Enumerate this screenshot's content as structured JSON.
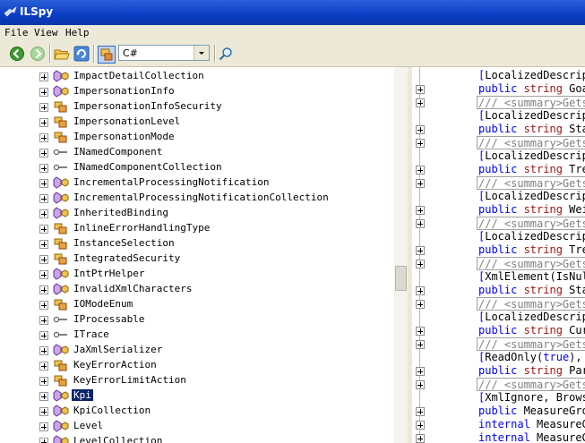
{
  "window": {
    "title": "ILSpy"
  },
  "menu": [
    "File",
    "View",
    "Help"
  ],
  "toolbar": {
    "language": "C#"
  },
  "tree": {
    "items": [
      {
        "label": "ImpactDetailCollection",
        "icon": "class"
      },
      {
        "label": "ImpersonationInfo",
        "icon": "class"
      },
      {
        "label": "ImpersonationInfoSecurity",
        "icon": "enum"
      },
      {
        "label": "ImpersonationLevel",
        "icon": "enum"
      },
      {
        "label": "ImpersonationMode",
        "icon": "enum"
      },
      {
        "label": "INamedComponent",
        "icon": "interface"
      },
      {
        "label": "INamedComponentCollection",
        "icon": "interface"
      },
      {
        "label": "IncrementalProcessingNotification",
        "icon": "class"
      },
      {
        "label": "IncrementalProcessingNotificationCollection",
        "icon": "class"
      },
      {
        "label": "InheritedBinding",
        "icon": "class"
      },
      {
        "label": "InlineErrorHandlingType",
        "icon": "enum"
      },
      {
        "label": "InstanceSelection",
        "icon": "enum"
      },
      {
        "label": "IntegratedSecurity",
        "icon": "enum"
      },
      {
        "label": "IntPtrHelper",
        "icon": "class"
      },
      {
        "label": "InvalidXmlCharacters",
        "icon": "class"
      },
      {
        "label": "IOModeEnum",
        "icon": "enum"
      },
      {
        "label": "IProcessable",
        "icon": "interface"
      },
      {
        "label": "ITrace",
        "icon": "interface"
      },
      {
        "label": "JaXmlSerializer",
        "icon": "class"
      },
      {
        "label": "KeyErrorAction",
        "icon": "enum"
      },
      {
        "label": "KeyErrorLimitAction",
        "icon": "enum"
      },
      {
        "label": "Kpi",
        "icon": "class",
        "selected": true
      },
      {
        "label": "KpiCollection",
        "icon": "class"
      },
      {
        "label": "Level",
        "icon": "class"
      },
      {
        "label": "LevelCollection",
        "icon": "class"
      }
    ]
  },
  "code": {
    "lines": [
      {
        "type": "attr",
        "parts": [
          [
            "br",
            "["
          ],
          [
            "pl",
            "LocalizedDescrip"
          ]
        ]
      },
      {
        "type": "prop",
        "parts": [
          [
            "kw",
            "public "
          ],
          [
            "kw2",
            "string "
          ],
          [
            "pl",
            "Goa"
          ]
        ]
      },
      {
        "type": "comment",
        "parts": [
          [
            "cm",
            "/// <summary>Gets"
          ]
        ]
      },
      {
        "type": "attr",
        "parts": [
          [
            "br",
            "["
          ],
          [
            "pl",
            "LocalizedDescrip"
          ]
        ]
      },
      {
        "type": "prop",
        "parts": [
          [
            "kw",
            "public "
          ],
          [
            "kw2",
            "string "
          ],
          [
            "pl",
            "Sta"
          ]
        ]
      },
      {
        "type": "comment",
        "parts": [
          [
            "cm",
            "/// <summary>Gets"
          ]
        ]
      },
      {
        "type": "attr",
        "parts": [
          [
            "br",
            "["
          ],
          [
            "pl",
            "LocalizedDescrip"
          ]
        ]
      },
      {
        "type": "prop",
        "parts": [
          [
            "kw",
            "public "
          ],
          [
            "kw2",
            "string "
          ],
          [
            "pl",
            "Tre"
          ]
        ]
      },
      {
        "type": "comment",
        "parts": [
          [
            "cm",
            "/// <summary>Gets"
          ]
        ]
      },
      {
        "type": "attr",
        "parts": [
          [
            "br",
            "["
          ],
          [
            "pl",
            "LocalizedDescrip"
          ]
        ]
      },
      {
        "type": "prop",
        "parts": [
          [
            "kw",
            "public "
          ],
          [
            "kw2",
            "string "
          ],
          [
            "pl",
            "Wei"
          ]
        ]
      },
      {
        "type": "comment",
        "parts": [
          [
            "cm",
            "/// <summary>Gets"
          ]
        ]
      },
      {
        "type": "attr",
        "parts": [
          [
            "br",
            "["
          ],
          [
            "pl",
            "LocalizedDescrip"
          ]
        ]
      },
      {
        "type": "prop",
        "parts": [
          [
            "kw",
            "public "
          ],
          [
            "kw2",
            "string "
          ],
          [
            "pl",
            "Tre"
          ]
        ]
      },
      {
        "type": "comment",
        "parts": [
          [
            "cm",
            "/// <summary>Gets"
          ]
        ]
      },
      {
        "type": "attr",
        "parts": [
          [
            "br",
            "["
          ],
          [
            "pl",
            "XmlElement(IsNul"
          ]
        ]
      },
      {
        "type": "prop",
        "parts": [
          [
            "kw",
            "public "
          ],
          [
            "kw2",
            "string "
          ],
          [
            "pl",
            "Sta"
          ]
        ]
      },
      {
        "type": "comment",
        "parts": [
          [
            "cm",
            "/// <summary>Gets"
          ]
        ]
      },
      {
        "type": "attr",
        "parts": [
          [
            "br",
            "["
          ],
          [
            "pl",
            "LocalizedDescrip"
          ]
        ]
      },
      {
        "type": "prop",
        "parts": [
          [
            "kw",
            "public "
          ],
          [
            "kw2",
            "string "
          ],
          [
            "pl",
            "Cur"
          ]
        ]
      },
      {
        "type": "comment",
        "parts": [
          [
            "cm",
            "/// <summary>Gets"
          ]
        ]
      },
      {
        "type": "attr",
        "parts": [
          [
            "br",
            "["
          ],
          [
            "pl",
            "ReadOnly("
          ],
          [
            "kw",
            "true"
          ],
          [
            "pl",
            "), "
          ]
        ]
      },
      {
        "type": "prop",
        "parts": [
          [
            "kw",
            "public "
          ],
          [
            "kw2",
            "string "
          ],
          [
            "pl",
            "Par"
          ]
        ]
      },
      {
        "type": "comment",
        "parts": [
          [
            "cm",
            "/// <summary>Gets"
          ]
        ]
      },
      {
        "type": "attr",
        "parts": [
          [
            "br",
            "["
          ],
          [
            "pl",
            "XmlIgnore, Brows"
          ]
        ]
      },
      {
        "type": "prop",
        "parts": [
          [
            "kw",
            "public "
          ],
          [
            "pl",
            "MeasureGro"
          ]
        ]
      },
      {
        "type": "prop",
        "parts": [
          [
            "kw",
            "internal "
          ],
          [
            "pl",
            "MeasureG"
          ]
        ]
      },
      {
        "type": "prop",
        "parts": [
          [
            "kw",
            "internal "
          ],
          [
            "pl",
            "MeasureG"
          ]
        ]
      }
    ]
  }
}
